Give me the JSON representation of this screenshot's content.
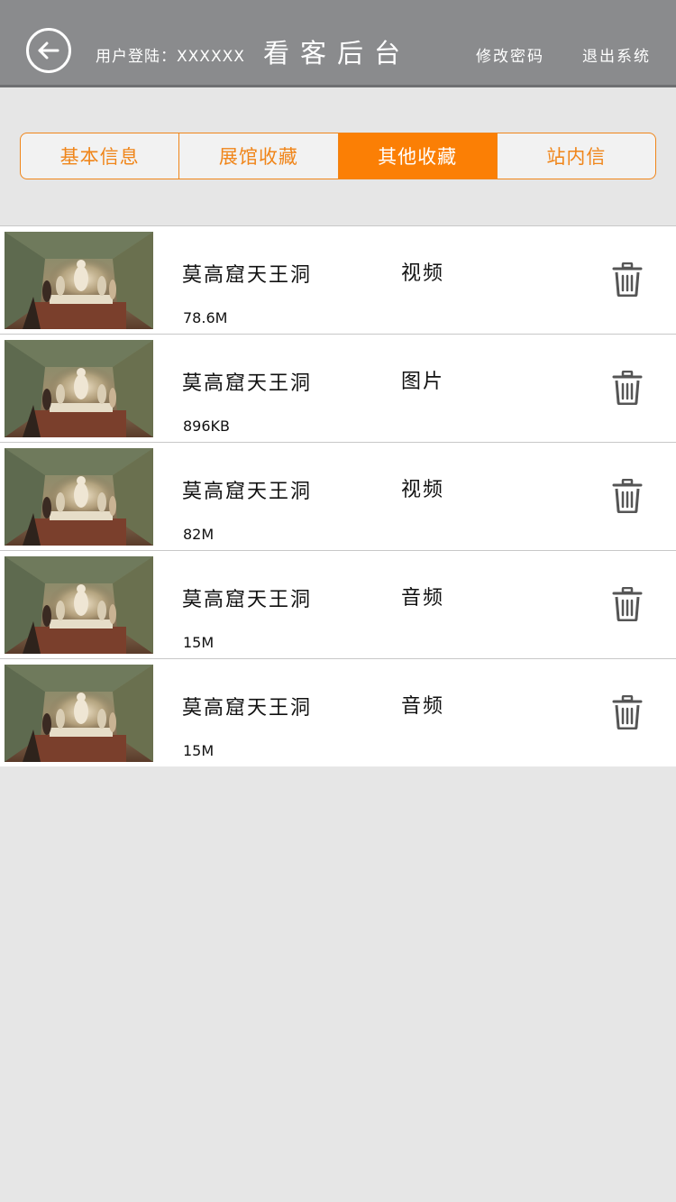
{
  "header": {
    "login_label": "用户登陆：XXXXXX",
    "title": "看客后台",
    "change_password": "修改密码",
    "logout": "退出系统",
    "back_icon": "arrow-left-circle-icon"
  },
  "tabs": [
    {
      "label": "基本信息",
      "active": false
    },
    {
      "label": "展馆收藏",
      "active": false
    },
    {
      "label": "其他收藏",
      "active": true
    },
    {
      "label": "站内信",
      "active": false
    }
  ],
  "colors": {
    "accent": "#fb7f05",
    "header_bg": "#8a8b8d",
    "page_bg": "#e6e6e6"
  },
  "items": [
    {
      "name": "莫高窟天王洞",
      "type": "视频",
      "size": "78.6M"
    },
    {
      "name": "莫高窟天王洞",
      "type": "图片",
      "size": "896KB"
    },
    {
      "name": "莫高窟天王洞",
      "type": "视频",
      "size": "82M"
    },
    {
      "name": "莫高窟天王洞",
      "type": "音频",
      "size": "15M"
    },
    {
      "name": "莫高窟天王洞",
      "type": "音频",
      "size": "15M"
    }
  ]
}
